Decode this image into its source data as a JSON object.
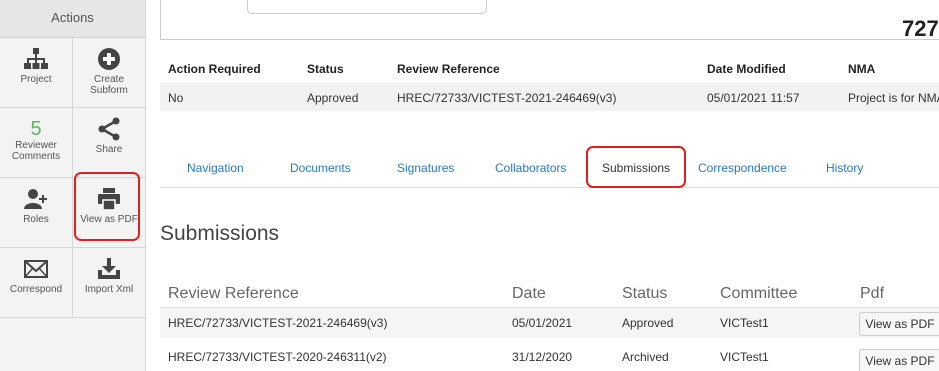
{
  "sidebar": {
    "title": "Actions",
    "items": [
      {
        "label": "Project",
        "icon": "sitemap-icon"
      },
      {
        "label": "Create Subform",
        "icon": "plus-circle-icon"
      },
      {
        "label": "Reviewer Comments",
        "count": "5"
      },
      {
        "label": "Share",
        "icon": "share-icon"
      },
      {
        "label": "Roles",
        "icon": "add-user-icon"
      },
      {
        "label": "View as PDF",
        "icon": "printer-icon"
      },
      {
        "label": "Correspond",
        "icon": "envelope-icon"
      },
      {
        "label": "Import Xml",
        "icon": "import-icon"
      }
    ]
  },
  "topbar": {
    "number": "727"
  },
  "summary": {
    "headers": [
      "Action Required",
      "Status",
      "Review Reference",
      "Date Modified",
      "NMA"
    ],
    "values": [
      "No",
      "Approved",
      "HREC/72733/VICTEST-2021-246469(v3)",
      "05/01/2021 11:57",
      "Project is for NMA"
    ]
  },
  "tabs": [
    "Navigation",
    "Documents",
    "Signatures",
    "Collaborators",
    "Submissions",
    "Correspondence",
    "History"
  ],
  "active_tab": "Submissions",
  "submissions": {
    "title": "Submissions",
    "columns": [
      "Review Reference",
      "Date",
      "Status",
      "Committee",
      "Pdf"
    ],
    "rows": [
      {
        "ref": "HREC/72733/VICTEST-2021-246469(v3)",
        "date": "05/01/2021",
        "status": "Approved",
        "committee": "VICTest1",
        "pdf": "View as PDF"
      },
      {
        "ref": "HREC/72733/VICTEST-2020-246311(v2)",
        "date": "31/12/2020",
        "status": "Archived",
        "committee": "VICTest1",
        "pdf": "View as PDF"
      }
    ]
  },
  "colors": {
    "highlight": "#e02020",
    "link": "#2a7ab8",
    "count": "#5cb85c"
  }
}
